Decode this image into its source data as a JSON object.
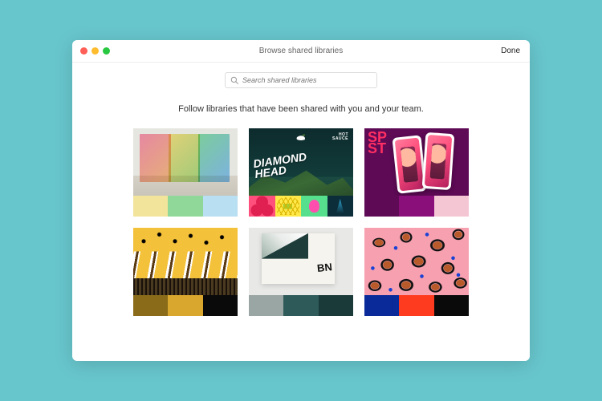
{
  "window": {
    "title": "Browse shared libraries",
    "done_label": "Done"
  },
  "search": {
    "placeholder": "Search shared libraries"
  },
  "tagline": "Follow libraries that have been shared with you and your team.",
  "cards": [
    {
      "id": "glass-panels",
      "swatches": [
        "#f2e49a",
        "#8fd89a",
        "#b8dff2"
      ]
    },
    {
      "id": "diamond-head",
      "title": "DIAMOND HEAD",
      "tag1": "HOT",
      "tag2": "SAUCE"
    },
    {
      "id": "spst-phones",
      "txt1": "SP\nST",
      "txt2": "SP",
      "swatches": [
        "#5e0a55",
        "#8a0f7a",
        "#f4c6d4"
      ]
    },
    {
      "id": "butterfly",
      "swatches": [
        "#8a6b1a",
        "#d9a72e",
        "#0a0a0a"
      ]
    },
    {
      "id": "page-curl",
      "logo": "BN",
      "swatches": [
        "#9aa6a4",
        "#2e5a5a",
        "#1a3a3a"
      ]
    },
    {
      "id": "leopard",
      "swatches": [
        "#0a2a9a",
        "#ff3b1f",
        "#0a0a0a"
      ]
    }
  ]
}
